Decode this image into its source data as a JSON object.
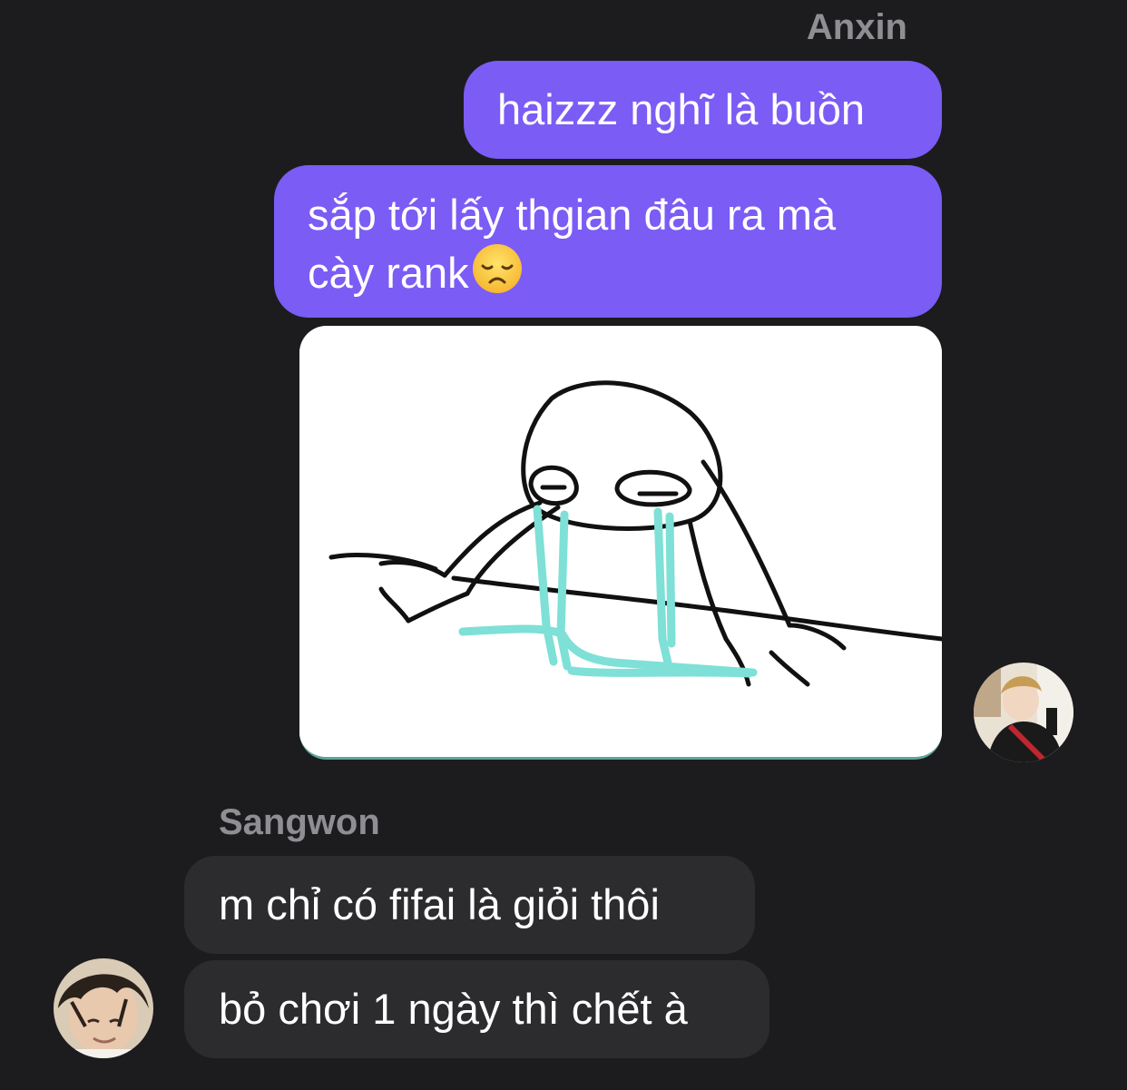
{
  "conversation": {
    "outgoing": {
      "sender_name": "Anxin",
      "messages": [
        {
          "text": "haizzz nghĩ là buồn"
        },
        {
          "text": "sắp tới lấy thgian đâu ra mà cày rank",
          "emoji": "disappointed-face-emoji"
        }
      ],
      "attachment": {
        "type": "image",
        "depicts": "crying-stick-figure-meme"
      },
      "avatar": "anxin-avatar"
    },
    "incoming": {
      "sender_name": "Sangwon",
      "messages": [
        {
          "text": "m chỉ có fifai là giỏi thôi"
        },
        {
          "text": "bỏ chơi 1 ngày thì chết à"
        }
      ],
      "avatar": "sangwon-avatar"
    }
  },
  "colors": {
    "background": "#1c1c1e",
    "outgoing_bubble": "#7b5cf5",
    "incoming_bubble": "#2c2c2e",
    "sender_name": "#8e8e93",
    "message_text": "#ffffff",
    "tears": "#7ee0d6"
  }
}
